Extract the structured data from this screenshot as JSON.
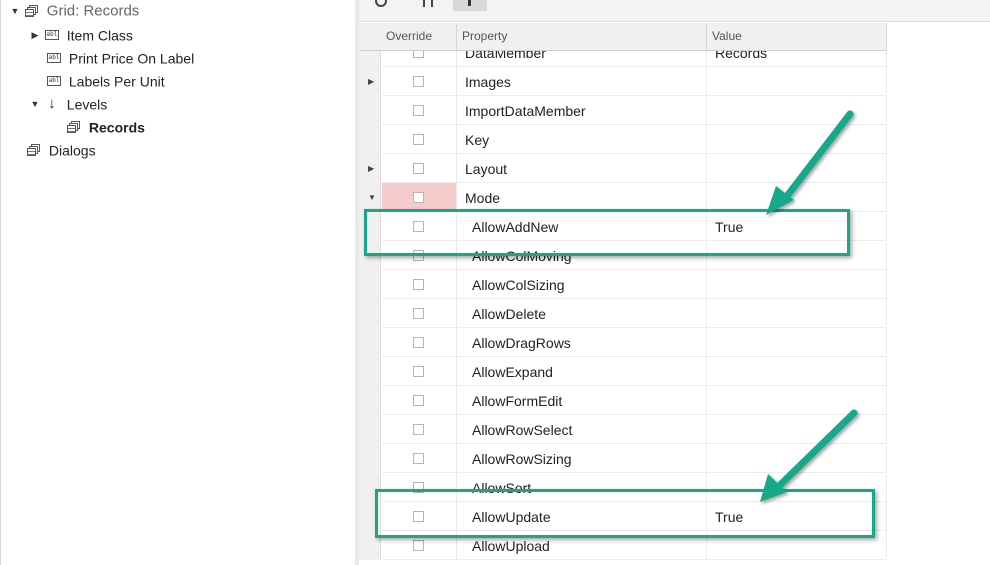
{
  "tree": {
    "items": [
      {
        "label": "Grid: Records"
      },
      {
        "label": "Item Class"
      },
      {
        "label": "Print Price On Label"
      },
      {
        "label": "Labels Per Unit"
      },
      {
        "label": "Levels"
      },
      {
        "label": "Records"
      },
      {
        "label": "Dialogs"
      }
    ]
  },
  "grid": {
    "columns": [
      "Override",
      "Property",
      "Value"
    ],
    "rows": [
      {
        "property": "DataMember",
        "value": "Records"
      },
      {
        "property": "Images",
        "value": ""
      },
      {
        "property": "ImportDataMember",
        "value": ""
      },
      {
        "property": "Key",
        "value": ""
      },
      {
        "property": "Layout",
        "value": ""
      },
      {
        "property": "Mode",
        "value": ""
      },
      {
        "property": "AllowAddNew",
        "value": "True"
      },
      {
        "property": "AllowColMoving",
        "value": ""
      },
      {
        "property": "AllowColSizing",
        "value": ""
      },
      {
        "property": "AllowDelete",
        "value": ""
      },
      {
        "property": "AllowDragRows",
        "value": ""
      },
      {
        "property": "AllowExpand",
        "value": ""
      },
      {
        "property": "AllowFormEdit",
        "value": ""
      },
      {
        "property": "AllowRowSelect",
        "value": ""
      },
      {
        "property": "AllowRowSizing",
        "value": ""
      },
      {
        "property": "AllowSort",
        "value": ""
      },
      {
        "property": "AllowUpdate",
        "value": "True"
      },
      {
        "property": "AllowUpload",
        "value": ""
      }
    ]
  },
  "colors": {
    "highlight_box": "#17a889",
    "mode_override_fill": "#f4cccc"
  },
  "icons": {
    "toolbar": [
      "refresh-icon",
      "columns-icon",
      "pin-icon"
    ],
    "tree": [
      "grid-icon",
      "field-icon",
      "arrow-down-icon"
    ]
  }
}
